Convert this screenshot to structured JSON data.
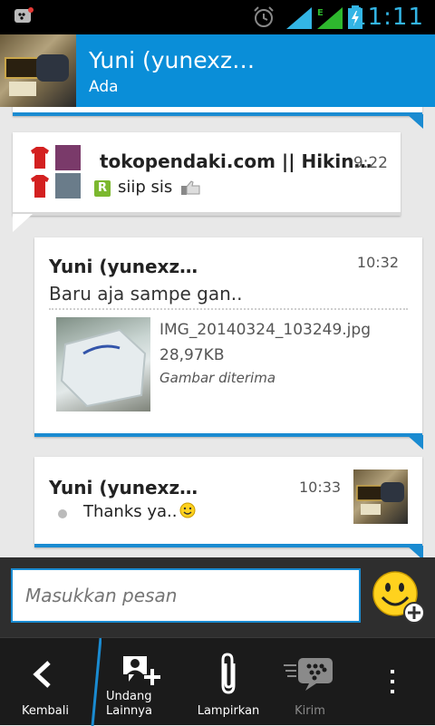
{
  "status_bar": {
    "time": "11:11",
    "network_label": "E"
  },
  "header": {
    "contact_name": "Yuni (yunexz…",
    "contact_status": "Ada"
  },
  "messages": [
    {
      "sender": "tokopendaki.com || Hikin…",
      "time": "9:22",
      "status_icon_letter": "R",
      "text": "siip sis"
    },
    {
      "sender": "Yuni (yunexz…",
      "time": "10:32",
      "text": "Baru aja sampe gan..",
      "attachment": {
        "file_name": "IMG_20140324_103249.jpg",
        "file_size": "28,97KB",
        "status": "Gambar diterima"
      }
    },
    {
      "sender": "Yuni (yunexz…",
      "time": "10:33",
      "text": "Thanks ya.."
    }
  ],
  "compose": {
    "placeholder": "Masukkan pesan"
  },
  "bottom_bar": {
    "back_label": "Kembali",
    "invite_label_line1": "Undang",
    "invite_label_line2": "Lainnya",
    "attach_label": "Lampirkan",
    "send_label": "Kirim"
  },
  "colors": {
    "accent": "#0a8ed8",
    "bubble_border": "#1a8bd1",
    "clock": "#33b5e5"
  }
}
